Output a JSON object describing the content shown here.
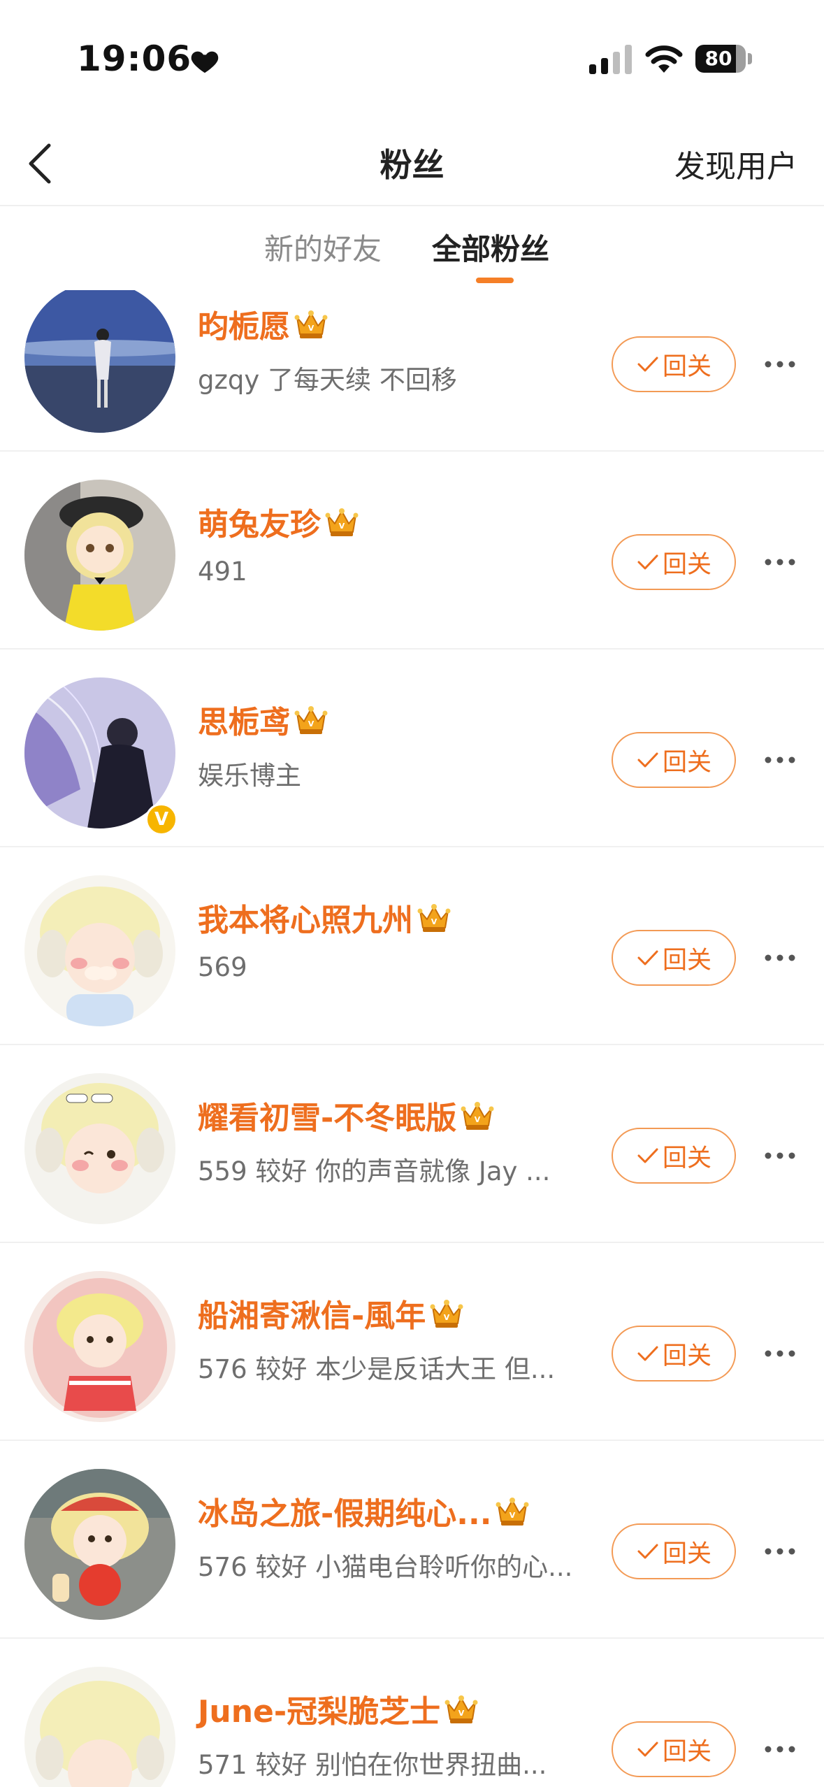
{
  "status_bar": {
    "time": "19:06",
    "battery": "80",
    "battery_level": 0.8
  },
  "nav": {
    "title": "粉丝",
    "discover_label": "发现用户"
  },
  "tabs": [
    {
      "label": "新的好友",
      "active": false
    },
    {
      "label": "全部粉丝",
      "active": true
    }
  ],
  "follow_back_label": "回关",
  "accent_color": "#ee6e1e",
  "fans": [
    {
      "name": "昀栀愿",
      "desc": "gzqy 了每天续 不回移",
      "verified": false
    },
    {
      "name": "萌兔友珍",
      "desc": "491",
      "verified": false
    },
    {
      "name": "思栀鸢",
      "desc": "娱乐博主",
      "verified": true
    },
    {
      "name": "我本将心照九州",
      "desc": "569",
      "verified": false
    },
    {
      "name": "耀看初雪-不冬眠版",
      "desc": "559 较好  你的声音就像 Jay ...",
      "verified": false
    },
    {
      "name": "船湘寄湫信-風年",
      "desc": "576 较好  本少是反话大王 但...",
      "verified": false
    },
    {
      "name": "冰岛之旅-假期纯心...",
      "desc": "576 较好 小猫电台聆听你的心...",
      "verified": false
    },
    {
      "name": "June-冠梨脆芝士",
      "desc": "571 较好  别怕在你世界扭曲...",
      "verified": false
    }
  ]
}
